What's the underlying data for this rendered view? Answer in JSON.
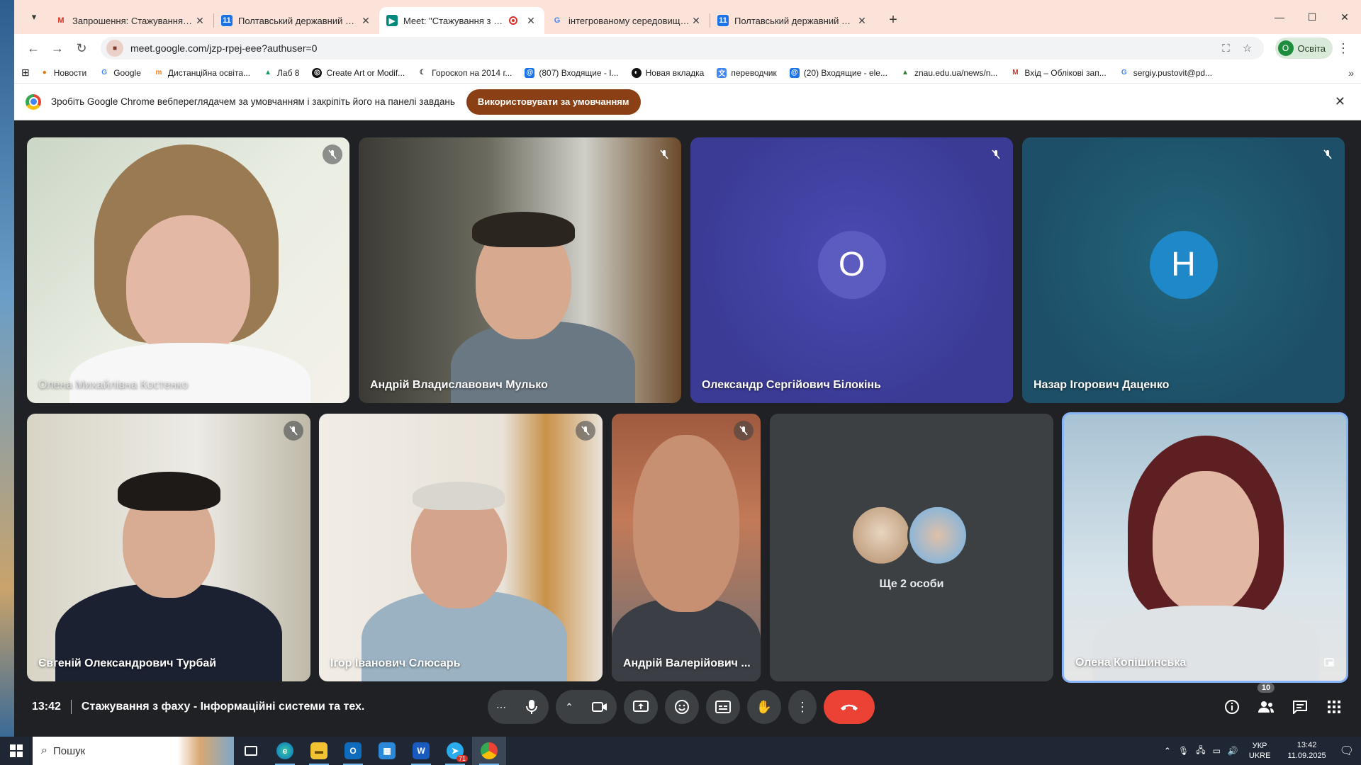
{
  "tabs": [
    {
      "title": "Запрошення: Стажування з фа",
      "icon": "gmail-icon",
      "active": false
    },
    {
      "title": "Полтавський державний агра",
      "icon": "calendar-icon",
      "active": false
    },
    {
      "title": "Meet: \"Стажування з фаху",
      "icon": "meet-icon",
      "active": true
    },
    {
      "title": "інтегрованому середовищі ро",
      "icon": "google-icon",
      "active": false
    },
    {
      "title": "Полтавський державний агра",
      "icon": "calendar-icon",
      "active": false
    }
  ],
  "address": {
    "url": "meet.google.com/jzp-rpej-eee?authuser=0"
  },
  "profile": {
    "initial": "О",
    "label": "Освіта"
  },
  "bookmarks": [
    "Новости",
    "Google",
    "Дистанційна освіта...",
    "Лаб 8",
    "Create Art or Modif...",
    "Гороскоп на 2014 г...",
    "(807) Входящие - I...",
    "Новая вкладка",
    "переводчик",
    "(20) Входящие - ele...",
    "znau.edu.ua/news/n...",
    "Вхід – Облікові зап...",
    "sergiy.pustovit@pd..."
  ],
  "infobar": {
    "message": "Зробіть Google Chrome вебпереглядачем за умовчанням і закріпіть його на панелі завдань",
    "button": "Використовувати за умовчанням"
  },
  "participants": [
    {
      "name": "Олена Михайлівна Костенко"
    },
    {
      "name": "Андрій Владиславович Мулько"
    },
    {
      "name": "Олександр Сергійович Білокінь",
      "initial": "О"
    },
    {
      "name": "Назар Ігорович Даценко",
      "initial": "Н"
    },
    {
      "name": "Євгеній Олександрович Турбай"
    },
    {
      "name": "Ігор Іванович Слюсарь"
    },
    {
      "name": "Андрій Валерійович ..."
    },
    {
      "name": "Олена Копішинська"
    }
  ],
  "more": {
    "label": "Ще 2 особи"
  },
  "meeting": {
    "time": "13:42",
    "title": "Стажування з фаху - Інформаційні системи та тех..."
  },
  "people_count": "10",
  "taskbar": {
    "search": "Пошук",
    "telegram_badge": "71",
    "lang_top": "УКР",
    "lang_bottom": "UKRE",
    "time": "13:42",
    "date": "11.09.2025"
  },
  "colors": {
    "tile_blue": "#3f3fa0",
    "tile_teal": "#1f5a70",
    "hangup": "#ea4335",
    "accent_button": "#8b3f14"
  }
}
